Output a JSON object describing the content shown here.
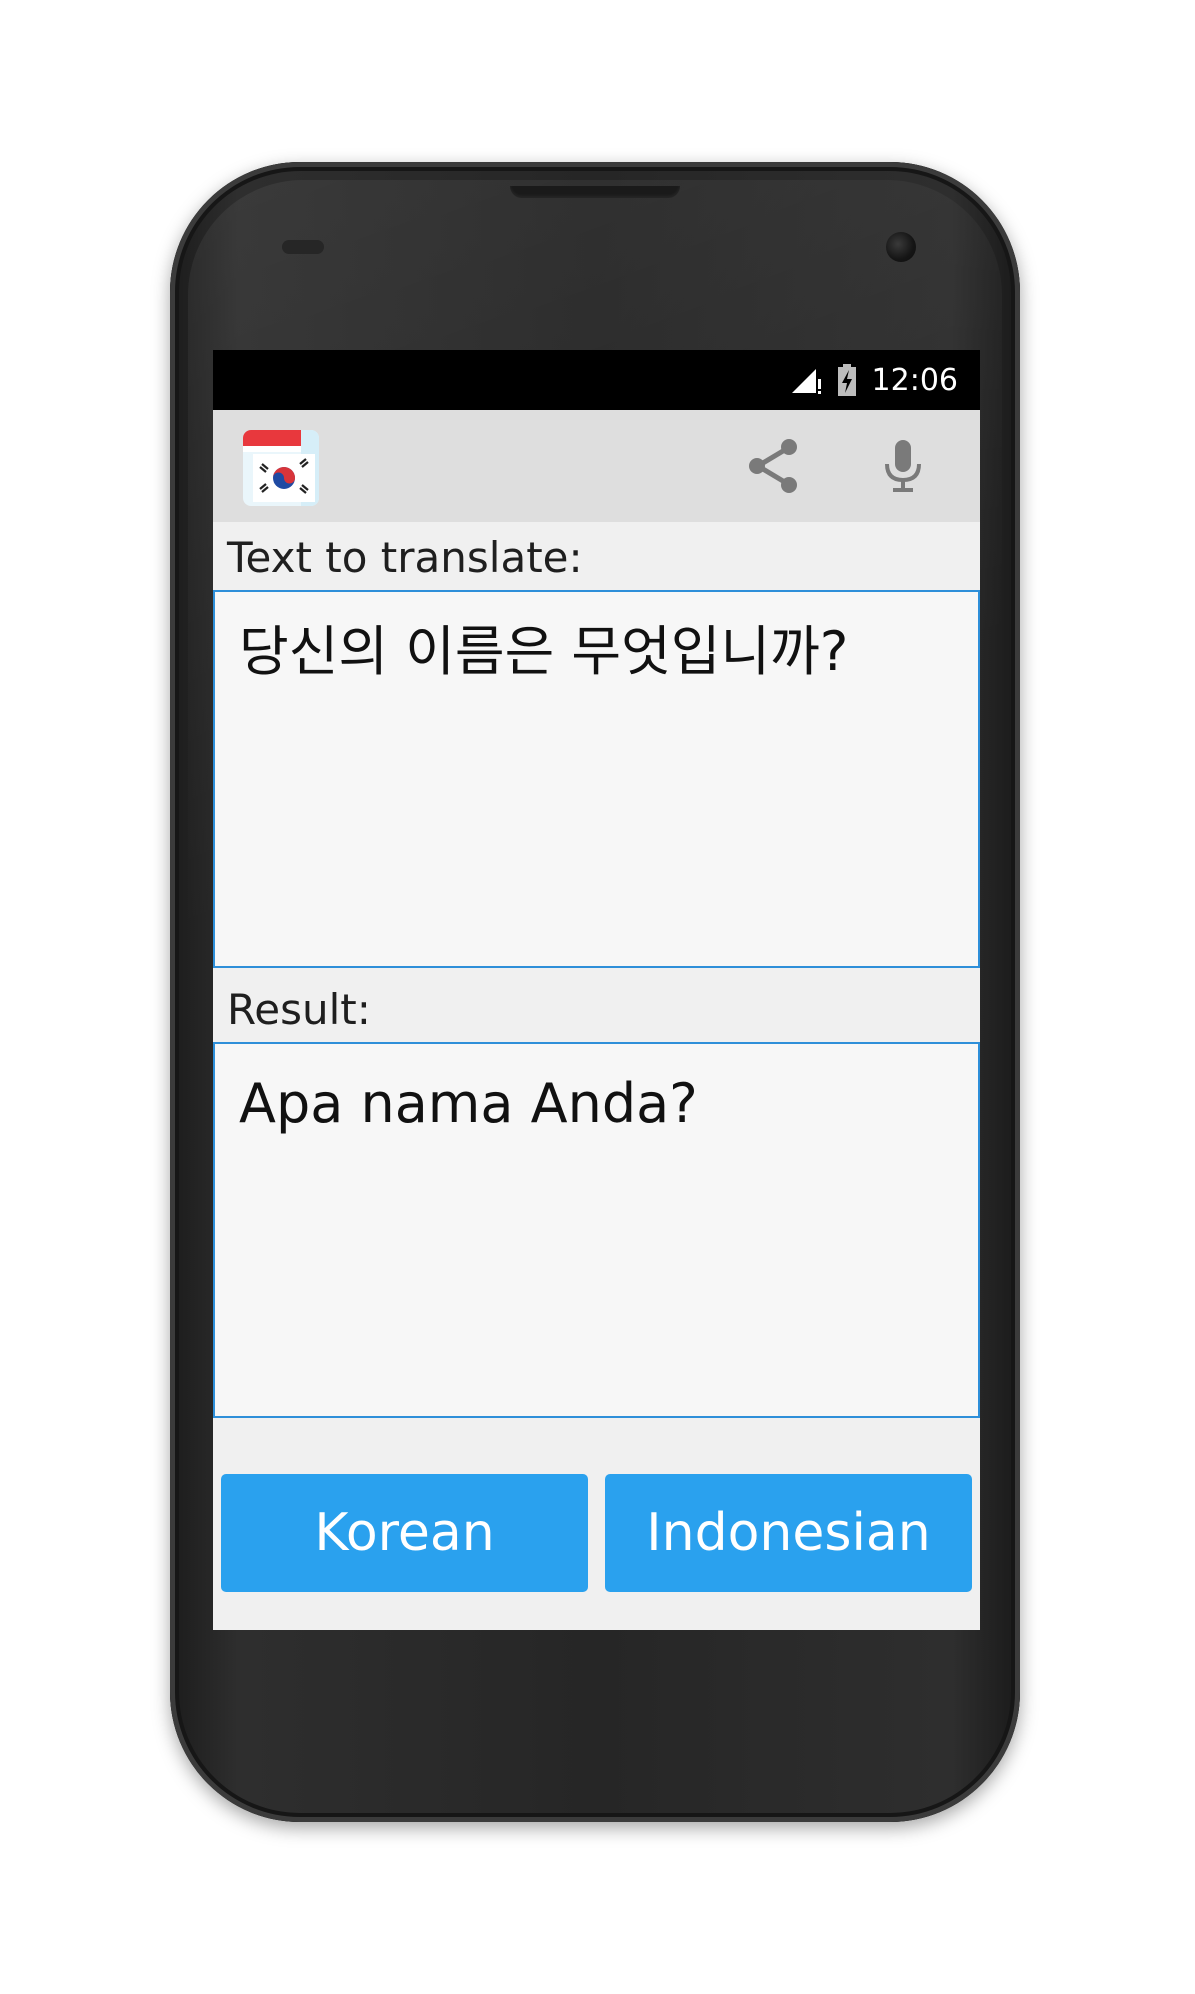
{
  "status_bar": {
    "time": "12:06",
    "signal_icon": "signal-icon",
    "battery_icon": "battery-charging-icon"
  },
  "app_bar": {
    "app_icon": "korean-flag-app-icon",
    "share_icon": "share-icon",
    "mic_icon": "microphone-icon"
  },
  "input": {
    "label": "Text to translate:",
    "value": "당신의 이름은 무엇입니까?"
  },
  "result": {
    "label": "Result:",
    "value": "Apa nama Anda?"
  },
  "languages": {
    "source": "Korean",
    "target": "Indonesian"
  },
  "colors": {
    "accent": "#2aa1ee",
    "border": "#2e8fd9",
    "appbar": "#dedede"
  }
}
